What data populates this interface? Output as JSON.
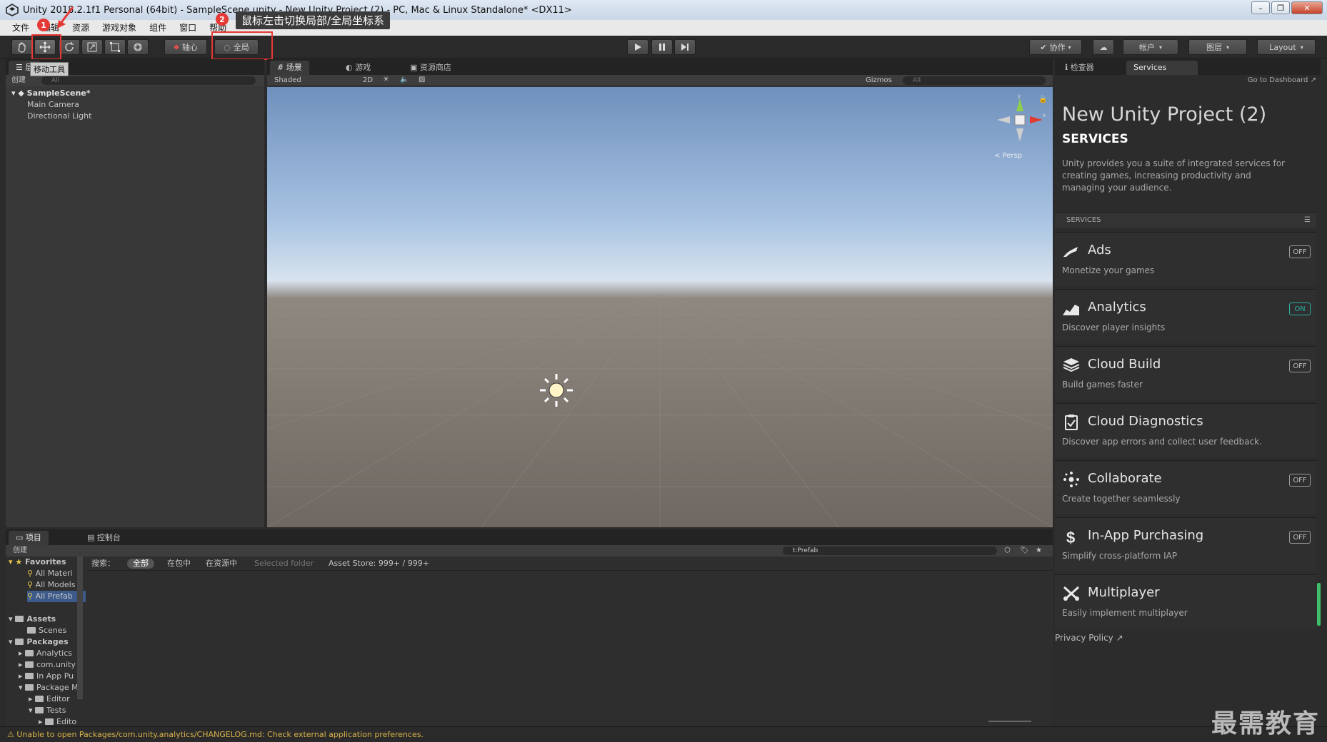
{
  "window": {
    "title": "Unity 2018.2.1f1 Personal (64bit) - SampleScene.unity - New Unity Project (2) - PC, Mac & Linux Standalone* <DX11>"
  },
  "menu": [
    "文件",
    "编辑",
    "资源",
    "游戏对象",
    "组件",
    "窗口",
    "帮助"
  ],
  "toolbar": {
    "pivot_label": "轴心",
    "global_label": "全局",
    "collab_label": "协作",
    "account_label": "帐户",
    "layers_label": "图层",
    "layout_label": "Layout"
  },
  "annotations": {
    "badge1": "1",
    "badge2": "2",
    "callout_text": "鼠标左击切换局部/全局坐标系",
    "tooltip_text": "移动工具"
  },
  "hierarchy": {
    "tab_label": "层",
    "create_label": "创建",
    "search_placeholder": "All",
    "scene_name": "SampleScene*",
    "items": [
      "Main Camera",
      "Directional Light"
    ]
  },
  "scene_view": {
    "tabs": [
      "场景",
      "游戏",
      "资源商店"
    ],
    "shading_mode": "Shaded",
    "mode_2d": "2D",
    "gizmos_label": "Gizmos",
    "search_placeholder": "All",
    "persp_label": "< Persp"
  },
  "inspector": {
    "tabs": [
      "检查器",
      "Services"
    ],
    "go_to_dashboard": "Go to Dashboard",
    "project_title": "New Unity Project (2)",
    "services_heading": "SERVICES",
    "intro": "Unity provides you a suite of integrated services for creating games, increasing productivity and managing your audience.",
    "services_section_label": "SERVICES",
    "services": [
      {
        "name": "Ads",
        "desc": "Monetize your games",
        "state": "OFF",
        "icon": "ads-icon"
      },
      {
        "name": "Analytics",
        "desc": "Discover player insights",
        "state": "ON",
        "icon": "analytics-icon"
      },
      {
        "name": "Cloud Build",
        "desc": "Build games faster",
        "state": "OFF",
        "icon": "cloud-build-icon"
      },
      {
        "name": "Cloud Diagnostics",
        "desc": "Discover app errors and collect user feedback.",
        "state": "",
        "icon": "cloud-diagnostics-icon"
      },
      {
        "name": "Collaborate",
        "desc": "Create together seamlessly",
        "state": "OFF",
        "icon": "collaborate-icon"
      },
      {
        "name": "In-App Purchasing",
        "desc": "Simplify cross-platform IAP",
        "state": "OFF",
        "icon": "iap-icon"
      },
      {
        "name": "Multiplayer",
        "desc": "Easily implement multiplayer",
        "state": "",
        "icon": "multiplayer-icon"
      }
    ],
    "privacy_policy": "Privacy Policy"
  },
  "project": {
    "tabs": [
      "项目",
      "控制台"
    ],
    "create_label": "创建",
    "search_value": "t:Prefab",
    "search_label": "搜索：",
    "filters": [
      "全部",
      "在包中",
      "在资源中",
      "Selected folder",
      "Asset Store: 999+ / 999+"
    ],
    "favorites_label": "Favorites",
    "favorites": [
      "All Materi",
      "All Models",
      "All Prefab"
    ],
    "assets_label": "Assets",
    "assets_children": [
      "Scenes"
    ],
    "packages_label": "Packages",
    "packages_children": [
      "Analytics",
      "com.unity",
      "In App Pu",
      "Package M"
    ],
    "package_manager_children": [
      "Editor",
      "Tests"
    ],
    "tests_children": [
      "Edito"
    ]
  },
  "status": {
    "message": "Unable to open Packages/com.unity.analytics/CHANGELOG.md: Check external application preferences."
  },
  "watermark": "最需教育",
  "colors": {
    "annotation_red": "#e53935",
    "toggle_on": "#2ab3a6",
    "status_warning": "#d8b24a"
  }
}
